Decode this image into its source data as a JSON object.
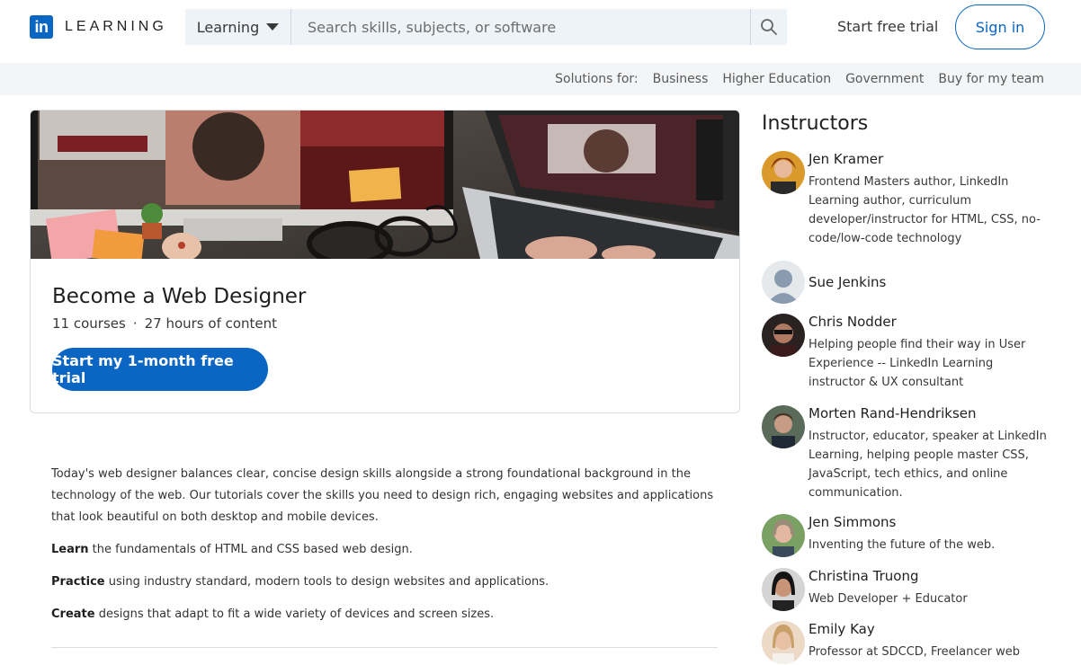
{
  "header": {
    "logo_text": "LEARNING",
    "category_select": "Learning",
    "search_placeholder": "Search skills, subjects, or software",
    "start_free_trial": "Start free trial",
    "sign_in": "Sign in"
  },
  "solutions": {
    "label": "Solutions for:",
    "links": [
      "Business",
      "Higher Education",
      "Government",
      "Buy for my team"
    ]
  },
  "course": {
    "title": "Become a Web Designer",
    "courses_count": "11 courses",
    "separator": "·",
    "hours": "27 hours of content",
    "cta": "Start my 1-month free trial"
  },
  "description": {
    "intro": "Today's web designer balances clear, concise design skills alongside a strong foundational background in the technology of the web. Our tutorials cover the skills you need to design rich, engaging websites and applications that look beautiful on both desktop and mobile devices.",
    "points": [
      {
        "bold": "Learn",
        "text": " the fundamentals of HTML and CSS based web design."
      },
      {
        "bold": "Practice",
        "text": " using industry standard, modern tools to design websites and applications."
      },
      {
        "bold": "Create",
        "text": " designs that adapt to fit a wide variety of devices and screen sizes."
      }
    ]
  },
  "instructors": {
    "title": "Instructors",
    "list": [
      {
        "name": "Jen Kramer",
        "bio": "Frontend Masters author, LinkedIn Learning author, curriculum developer/instructor for HTML, CSS, no-code/low-code technology"
      },
      {
        "name": "Sue Jenkins",
        "bio": ""
      },
      {
        "name": "Chris Nodder",
        "bio": "Helping people find their way in User Experience -- LinkedIn Learning instructor & UX consultant"
      },
      {
        "name": "Morten Rand-Hendriksen",
        "bio": "Instructor, educator, speaker at LinkedIn Learning, helping people master CSS, JavaScript, tech ethics, and online communication."
      },
      {
        "name": "Jen Simmons",
        "bio": "Inventing the future of the web."
      },
      {
        "name": "Christina Truong",
        "bio": "Web Developer + Educator"
      },
      {
        "name": "Emily Kay",
        "bio": "Professor at SDCCD, Freelancer web"
      }
    ]
  },
  "colors": {
    "brand": "#0a66c2",
    "solbar_bg": "#f3f5f7",
    "search_bg": "#eef3f8"
  }
}
